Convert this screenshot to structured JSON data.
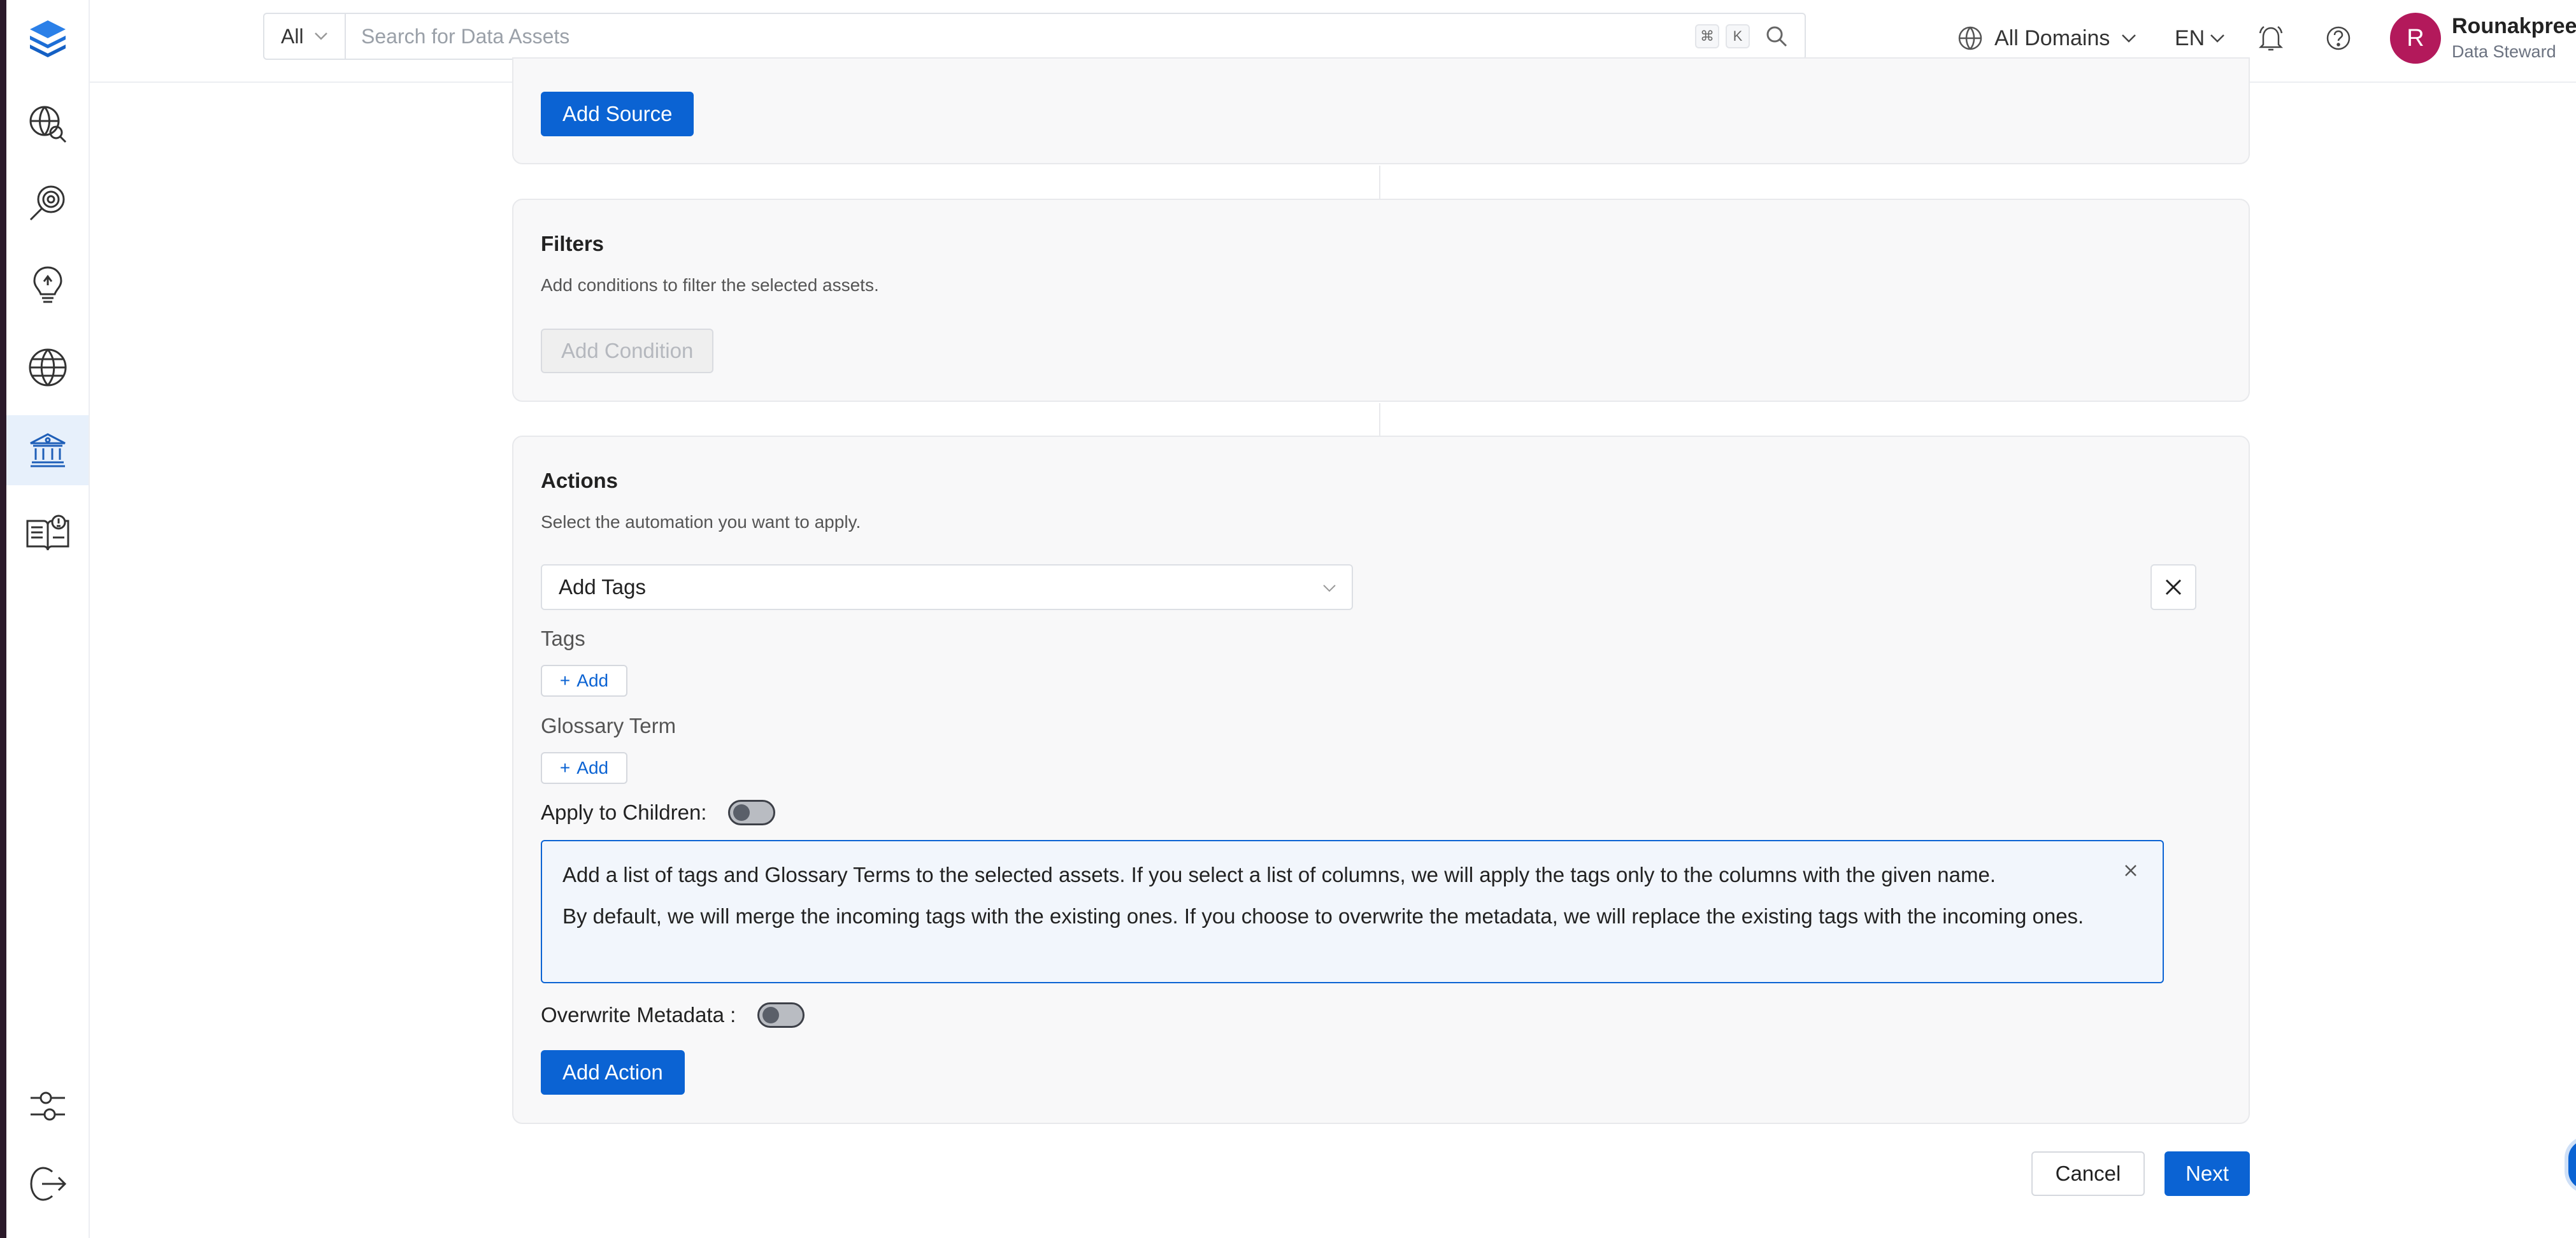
{
  "header": {
    "search_scope": "All",
    "search_placeholder": "Search for Data Assets",
    "shortcut_key_1": "⌘",
    "shortcut_key_2": "K",
    "domain_selector": "All Domains",
    "language": "EN",
    "user": {
      "initial": "R",
      "name": "Rounakpreet",
      "role": "Data Steward"
    }
  },
  "sidebar": {
    "items": [
      {
        "icon": "layers-logo-icon"
      },
      {
        "icon": "explore-icon"
      },
      {
        "icon": "data-quality-icon"
      },
      {
        "icon": "insights-icon"
      },
      {
        "icon": "domains-icon"
      },
      {
        "icon": "governance-icon",
        "active": true
      },
      {
        "icon": "knowledge-center-icon"
      },
      {
        "icon": "settings-icon"
      },
      {
        "icon": "logout-icon"
      }
    ]
  },
  "source": {
    "add_source_label": "Add Source"
  },
  "filters": {
    "title": "Filters",
    "description": "Add conditions to filter the selected assets.",
    "add_condition_label": "Add Condition"
  },
  "actions": {
    "title": "Actions",
    "description": "Select the automation you want to apply.",
    "selected_action": "Add Tags",
    "tags_label": "Tags",
    "tags_add_label": "Add",
    "glossary_label": "Glossary Term",
    "glossary_add_label": "Add",
    "apply_children_label": "Apply to Children:",
    "apply_children_on": false,
    "info_line_1": "Add a list of tags and Glossary Terms to the selected assets. If you select a list of columns, we will apply the tags only to the columns with the given name.",
    "info_line_2": "By default, we will merge the incoming tags with the existing ones. If you choose to overwrite the metadata, we will replace the existing tags with the incoming ones.",
    "overwrite_label": "Overwrite Metadata :",
    "overwrite_on": false,
    "add_action_label": "Add Action"
  },
  "footer": {
    "cancel_label": "Cancel",
    "next_label": "Next"
  },
  "colors": {
    "primary": "#0b63d3",
    "avatar": "#b3195b",
    "sidebar_active_bg": "#e7f0fb"
  }
}
